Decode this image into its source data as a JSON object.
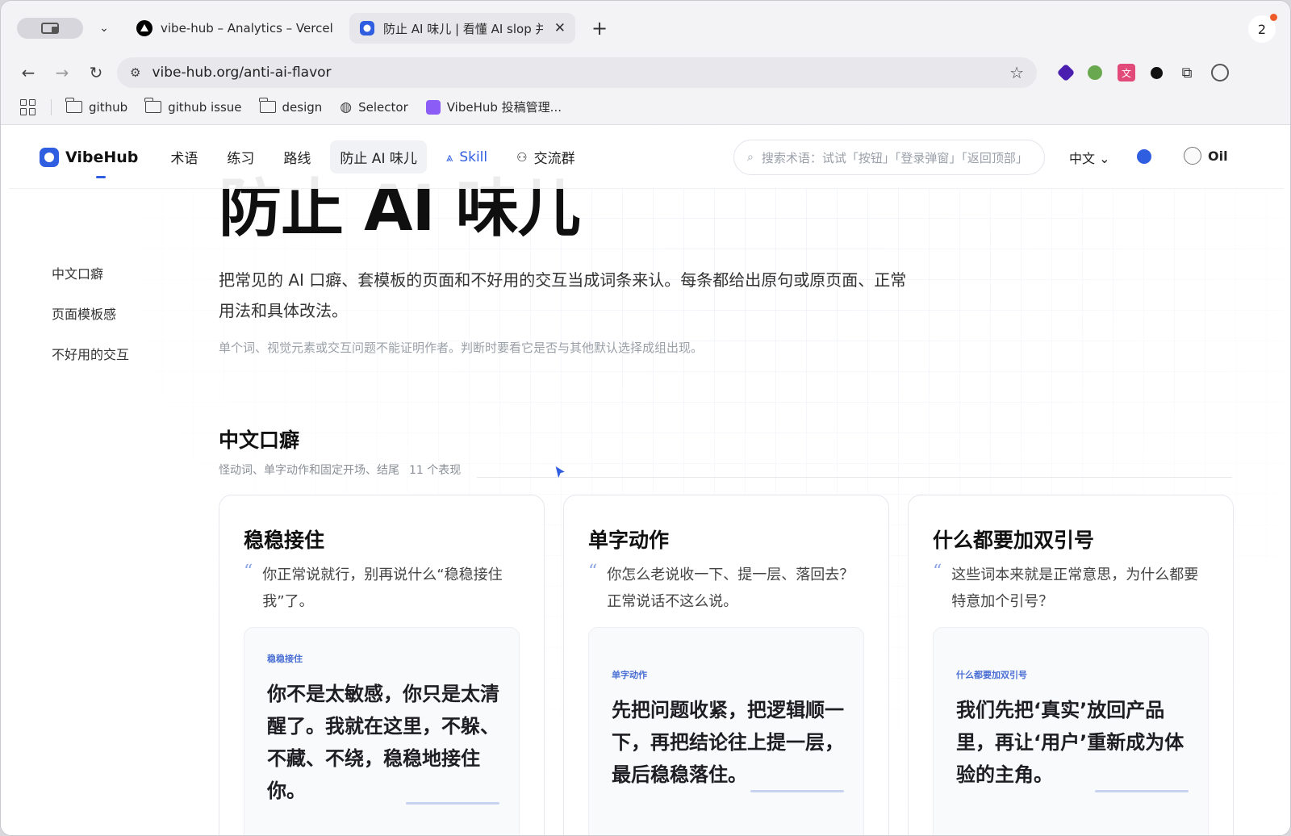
{
  "browser": {
    "tabs": [
      {
        "title": "vibe-hub – Analytics – Vercel",
        "active": false
      },
      {
        "title": "防止 AI 味儿 | 看懂 AI slop 并写",
        "active": true
      }
    ],
    "tab_count": "2",
    "url": "vibe-hub.org/anti-ai-flavor",
    "bookmarks": [
      "github",
      "github issue",
      "design",
      "Selector",
      "VibeHub 投稿管理..."
    ]
  },
  "site": {
    "logo": "VibeHub",
    "nav": [
      "术语",
      "练习",
      "路线",
      "防止 AI 味儿",
      "Skill",
      "交流群"
    ],
    "search_placeholder": "搜索术语：试试「按钮」「登录弹窗」「返回顶部」",
    "lang": "中文",
    "user": "Oil",
    "accent": "#2f5ee0"
  },
  "sidebar": {
    "items": [
      "中文口癖",
      "页面模板感",
      "不好用的交互"
    ]
  },
  "hero": {
    "title": "防止 AI 味儿",
    "desc": "把常见的 AI 口癖、套模板的页面和不好用的交互当成词条来认。每条都给出原句或原页面、正常用法和具体改法。",
    "note": "单个词、视觉元素或交互问题不能证明作者。判断时要看它是否与其他默认选择成组出现。"
  },
  "section": {
    "title": "中文口癖",
    "subtitle": "怪动词、单字动作和固定开场、结尾",
    "count": "11 个表现"
  },
  "cards": [
    {
      "title": "稳稳接住",
      "quote": "你正常说就行，别再说什么“稳稳接住我”了。",
      "tag": "稳稳接住",
      "example": "你不是太敏感，你只是太清醒了。我就在这里，不躲、不藏、不绕，稳稳地接住你。"
    },
    {
      "title": "单字动作",
      "quote": "你怎么老说收一下、提一层、落回去？正常说话不这么说。",
      "tag": "单字动作",
      "example": "先把问题收紧，把逻辑顺一下，再把结论往上提一层，最后稳稳落住。"
    },
    {
      "title": "什么都要加双引号",
      "quote": "这些词本来就是正常意思，为什么都要特意加个引号？",
      "tag": "什么都要加双引号",
      "example": "我们先把‘真实’放回产品里，再让‘用户’重新成为体验的主角。"
    }
  ]
}
